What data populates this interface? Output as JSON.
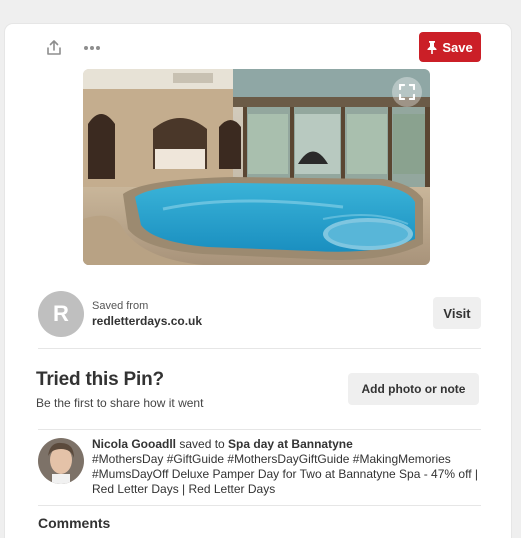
{
  "pin": {
    "save_label": "Save",
    "share_icon": "share-icon",
    "more_icon": "more-horizontal-icon",
    "expand_icon": "expand-icon",
    "image_description": "indoor swimming pool photo"
  },
  "source": {
    "avatar_letter": "R",
    "saved_from_label": "Saved from",
    "domain": "redletterdays.co.uk",
    "visit_label": "Visit"
  },
  "tried": {
    "title": "Tried this Pin?",
    "subtitle": "Be the first to share how it went",
    "add_photo_label": "Add photo or note"
  },
  "activity": {
    "user_name": "Nicola Gooadll",
    "saved_to_text": " saved to ",
    "board_name": "Spa day at Bannatyne",
    "description": "#MothersDay #GiftGuide #MothersDayGiftGuide #MakingMemories #MumsDayOff Deluxe Pamper Day for Two at Bannatyne Spa - 47% off | Red Letter Days | Red Letter Days"
  },
  "comments": {
    "title": "Comments"
  },
  "colors": {
    "save_button": "#cb1f27",
    "secondary_button": "#efefef",
    "page_bg": "#efefef"
  }
}
